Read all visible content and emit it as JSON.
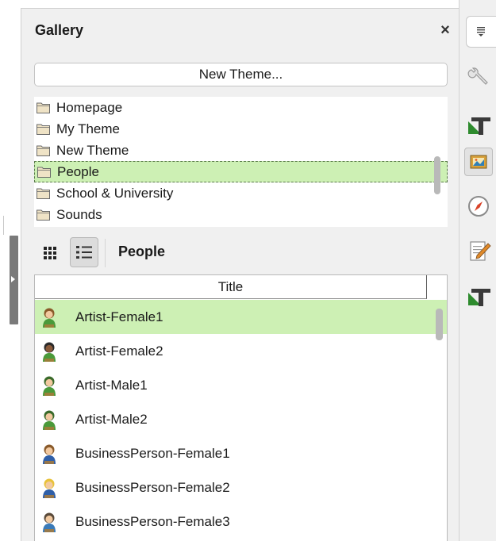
{
  "panel": {
    "title": "Gallery",
    "close_label": "×",
    "new_theme_label": "New Theme..."
  },
  "themes": [
    {
      "label": "Homepage",
      "selected": false
    },
    {
      "label": "My Theme",
      "selected": false
    },
    {
      "label": "New Theme",
      "selected": false
    },
    {
      "label": "People",
      "selected": true
    },
    {
      "label": "School & University",
      "selected": false
    },
    {
      "label": "Sounds",
      "selected": false
    }
  ],
  "view": {
    "current_theme": "People",
    "column_title": "Title"
  },
  "items": [
    {
      "label": "Artist-Female1",
      "selected": true,
      "icon": "artist-female-icon"
    },
    {
      "label": "Artist-Female2",
      "selected": false,
      "icon": "artist-female-dark-icon"
    },
    {
      "label": "Artist-Male1",
      "selected": false,
      "icon": "artist-male-icon"
    },
    {
      "label": "Artist-Male2",
      "selected": false,
      "icon": "artist-male-icon"
    },
    {
      "label": "BusinessPerson-Female1",
      "selected": false,
      "icon": "business-female-icon"
    },
    {
      "label": "BusinessPerson-Female2",
      "selected": false,
      "icon": "business-female-blonde-icon"
    },
    {
      "label": "BusinessPerson-Female3",
      "selected": false,
      "icon": "business-female-blue-icon"
    }
  ],
  "tabs": [
    {
      "name": "sidebar-menu-tab",
      "icon": "menu-icon"
    },
    {
      "name": "properties-tab",
      "icon": "wrench-icon"
    },
    {
      "name": "styles-tab",
      "icon": "styles-icon"
    },
    {
      "name": "gallery-tab",
      "icon": "gallery-icon",
      "active": true
    },
    {
      "name": "navigator-tab",
      "icon": "compass-icon"
    },
    {
      "name": "manage-changes-tab",
      "icon": "edit-icon"
    },
    {
      "name": "design-tab",
      "icon": "styles-icon"
    }
  ],
  "colors": {
    "selection": "#cdf0b4",
    "panel_bg": "#f0f0f0"
  }
}
